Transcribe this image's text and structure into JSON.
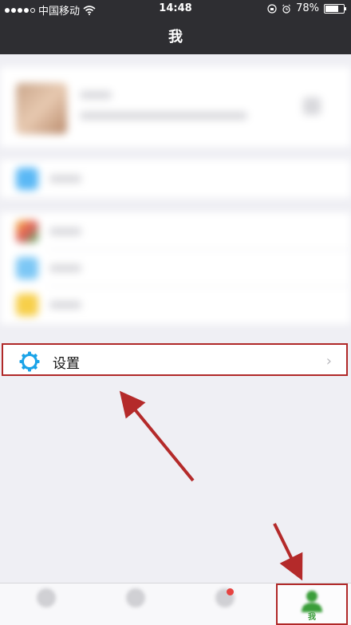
{
  "status_bar": {
    "carrier": "中国移动",
    "time": "14:48",
    "battery": "78%",
    "battery_level": 0.78
  },
  "nav": {
    "title": "我"
  },
  "settings_row": {
    "label": "设置",
    "chevron": "›"
  },
  "tab_bar": {
    "active_label": "我"
  },
  "colors": {
    "accent_green": "#3a9e3a",
    "highlight_red": "#b02828",
    "gear_blue": "#1aa3e8",
    "nav_dark": "#2e2e32"
  },
  "icons": [
    "signal-dots-icon",
    "wifi-icon",
    "alarm-icon",
    "lock-rotation-icon",
    "battery-icon",
    "gear-icon",
    "chevron-right-icon",
    "person-icon"
  ]
}
